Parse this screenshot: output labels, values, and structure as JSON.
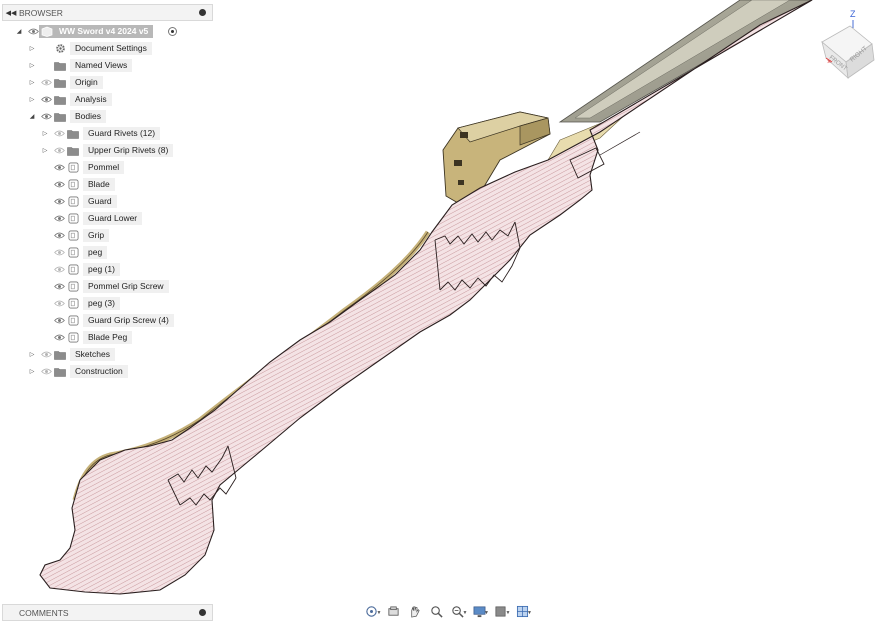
{
  "browser": {
    "header": "BROWSER",
    "items": [
      {
        "label": "WW Sword v4 2024 v5",
        "icon": "component-icon",
        "level": 0,
        "expander": "expanded",
        "eye": true,
        "root": true
      },
      {
        "label": "Document Settings",
        "icon": "gear-icon",
        "level": 1,
        "expander": "collapsed",
        "eye": false
      },
      {
        "label": "Named Views",
        "icon": "folder-icon",
        "level": 1,
        "expander": "collapsed",
        "eye": false
      },
      {
        "label": "Origin",
        "icon": "folder-icon",
        "level": 1,
        "expander": "collapsed",
        "eye": true,
        "eye_hidden": true
      },
      {
        "label": "Analysis",
        "icon": "folder-icon",
        "level": 1,
        "expander": "collapsed",
        "eye": true
      },
      {
        "label": "Bodies",
        "icon": "folder-icon",
        "level": 1,
        "expander": "expanded",
        "eye": true
      },
      {
        "label": "Guard Rivets (12)",
        "icon": "folder-icon",
        "level": 2,
        "expander": "collapsed",
        "eye": true,
        "eye_hidden": true
      },
      {
        "label": "Upper Grip Rivets (8)",
        "icon": "folder-icon",
        "level": 2,
        "expander": "collapsed",
        "eye": true,
        "eye_hidden": true
      },
      {
        "label": "Pommel",
        "icon": "body-icon",
        "level": 2,
        "expander": "none",
        "eye": true
      },
      {
        "label": "Blade",
        "icon": "body-icon",
        "level": 2,
        "expander": "none",
        "eye": true
      },
      {
        "label": "Guard",
        "icon": "body-icon",
        "level": 2,
        "expander": "none",
        "eye": true
      },
      {
        "label": "Guard Lower",
        "icon": "body-icon",
        "level": 2,
        "expander": "none",
        "eye": true
      },
      {
        "label": "Grip",
        "icon": "body-icon",
        "level": 2,
        "expander": "none",
        "eye": true
      },
      {
        "label": "peg",
        "icon": "body-icon",
        "level": 2,
        "expander": "none",
        "eye": true,
        "eye_hidden": true
      },
      {
        "label": "peg (1)",
        "icon": "body-icon",
        "level": 2,
        "expander": "none",
        "eye": true,
        "eye_hidden": true
      },
      {
        "label": "Pommel Grip Screw",
        "icon": "body-icon",
        "level": 2,
        "expander": "none",
        "eye": true
      },
      {
        "label": "peg (3)",
        "icon": "body-icon",
        "level": 2,
        "expander": "none",
        "eye": true,
        "eye_hidden": true
      },
      {
        "label": "Guard Grip Screw (4)",
        "icon": "body-icon",
        "level": 2,
        "expander": "none",
        "eye": true
      },
      {
        "label": "Blade Peg",
        "icon": "body-icon",
        "level": 2,
        "expander": "none",
        "eye": true
      },
      {
        "label": "Sketches",
        "icon": "folder-icon",
        "level": 1,
        "expander": "collapsed",
        "eye": true,
        "eye_hidden": true
      },
      {
        "label": "Construction",
        "icon": "folder-icon",
        "level": 1,
        "expander": "collapsed",
        "eye": true,
        "eye_hidden": true
      }
    ]
  },
  "comments": {
    "header": "COMMENTS"
  },
  "viewcube": {
    "axis_label": "Z",
    "face_front": "FRONT",
    "face_right": "RIGHT"
  },
  "toolbar": {
    "tools": [
      {
        "icon": "orbit-icon",
        "dropdown": true
      },
      {
        "icon": "look-at-icon",
        "dropdown": false
      },
      {
        "icon": "pan-hand-icon",
        "dropdown": false
      },
      {
        "icon": "zoom-icon",
        "dropdown": false
      },
      {
        "icon": "fit-zoom-icon",
        "dropdown": true
      },
      {
        "icon": "display-settings-icon",
        "dropdown": true
      },
      {
        "icon": "visual-style-icon",
        "dropdown": true
      },
      {
        "icon": "grid-icon",
        "dropdown": true
      }
    ]
  },
  "colors": {
    "section_fill": "#f2e1e3",
    "section_hatch": "#b06b73",
    "section_edge": "#2a1f1f",
    "guard_tan": "#c9b57c",
    "guard_tan_dark": "#8f7c48",
    "blade_grey": "#9a9a90",
    "accent_eye": "#777777"
  }
}
